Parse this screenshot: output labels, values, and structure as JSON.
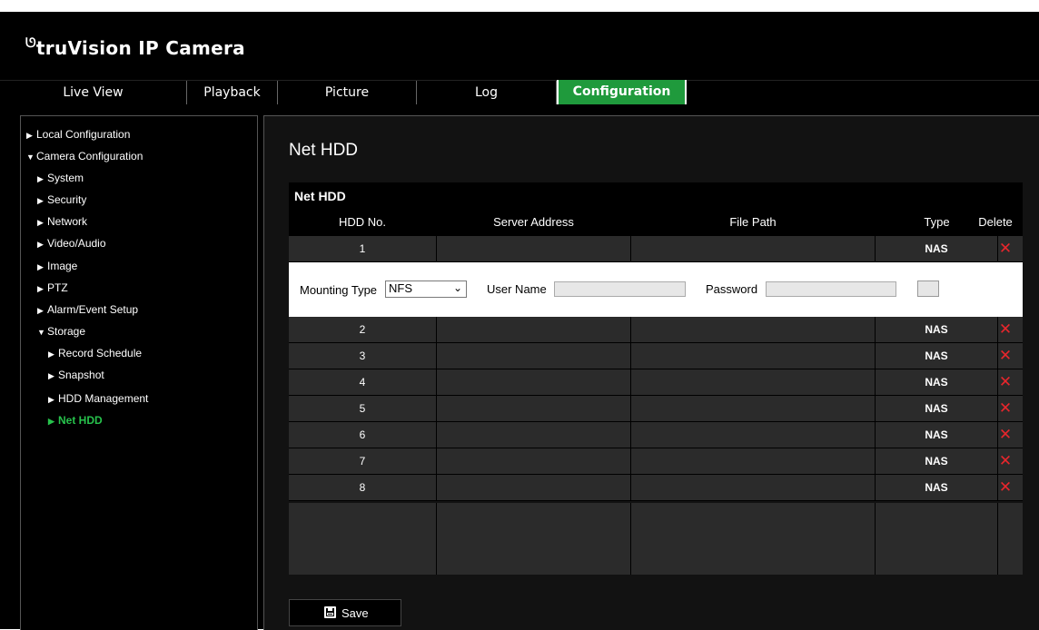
{
  "app": {
    "brand": "truVision  IP Camera",
    "logo_mark": "ᘎ"
  },
  "nav": {
    "tabs": [
      {
        "label": "Live View"
      },
      {
        "label": "Playback"
      },
      {
        "label": "Picture"
      },
      {
        "label": "Log"
      },
      {
        "label": "Configuration",
        "active": true
      }
    ]
  },
  "sidebar": {
    "items": [
      {
        "label": "Local Configuration",
        "expanded": false
      },
      {
        "label": "Camera Configuration",
        "expanded": true
      },
      {
        "label": "System",
        "expanded": false
      },
      {
        "label": "Security",
        "expanded": false
      },
      {
        "label": "Network",
        "expanded": false
      },
      {
        "label": "Video/Audio",
        "expanded": false
      },
      {
        "label": "Image",
        "expanded": false
      },
      {
        "label": "PTZ",
        "expanded": false
      },
      {
        "label": "Alarm/Event Setup",
        "expanded": false
      },
      {
        "label": "Storage",
        "expanded": true
      },
      {
        "label": "Record Schedule",
        "expanded": false
      },
      {
        "label": "Snapshot",
        "expanded": false
      },
      {
        "label": "HDD Management",
        "expanded": false
      },
      {
        "label": "Net HDD",
        "expanded": false,
        "active": true
      }
    ]
  },
  "page": {
    "title": "Net HDD"
  },
  "table": {
    "title": "Net HDD",
    "columns": [
      "HDD No.",
      "Server Address",
      "File Path",
      "Type",
      "Delete"
    ],
    "rows": [
      {
        "no": "1",
        "server": "",
        "path": "",
        "type": "NAS",
        "delete": "✕"
      },
      {
        "no": "2",
        "server": "",
        "path": "",
        "type": "NAS",
        "delete": "✕"
      },
      {
        "no": "3",
        "server": "",
        "path": "",
        "type": "NAS",
        "delete": "✕"
      },
      {
        "no": "4",
        "server": "",
        "path": "",
        "type": "NAS",
        "delete": "✕"
      },
      {
        "no": "5",
        "server": "",
        "path": "",
        "type": "NAS",
        "delete": "✕"
      },
      {
        "no": "6",
        "server": "",
        "path": "",
        "type": "NAS",
        "delete": "✕"
      },
      {
        "no": "7",
        "server": "",
        "path": "",
        "type": "NAS",
        "delete": "✕"
      },
      {
        "no": "8",
        "server": "",
        "path": "",
        "type": "NAS",
        "delete": "✕"
      }
    ]
  },
  "mount": {
    "type_label": "Mounting Type",
    "type_value": "NFS",
    "user_label": "User Name",
    "user_value": "",
    "password_label": "Password",
    "password_value": ""
  },
  "actions": {
    "save_label": "Save"
  },
  "colors": {
    "accent": "#1f9a3c",
    "active_text": "#27c24c",
    "delete": "#e8262c"
  },
  "icons": {
    "save": "floppy-disk-icon",
    "delete": "close-icon",
    "expand": "triangle-right-icon",
    "collapse": "triangle-down-icon"
  }
}
